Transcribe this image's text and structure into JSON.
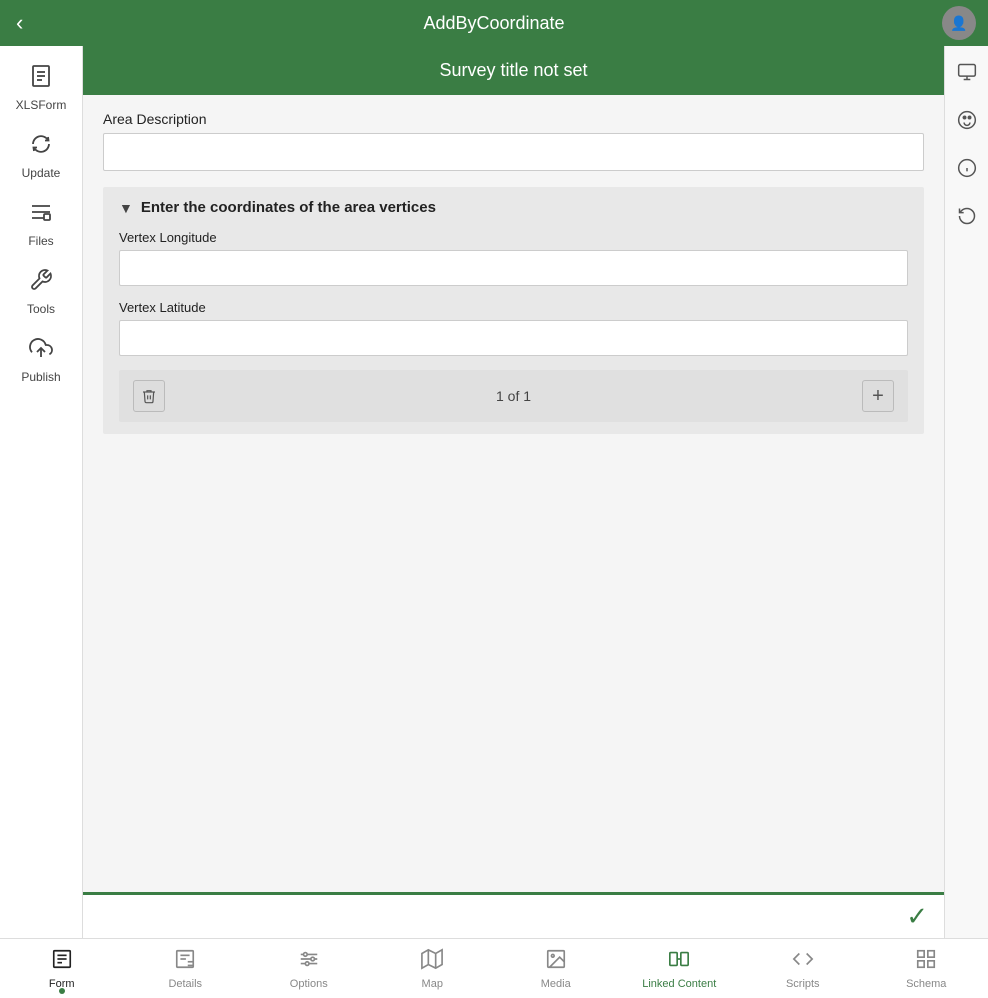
{
  "app": {
    "title": "AddByCoordinate",
    "back_label": "‹"
  },
  "survey": {
    "title": "Survey title not set"
  },
  "form": {
    "area_description_label": "Area Description",
    "area_description_value": "",
    "coord_section_title": "Enter the coordinates of the area vertices",
    "vertex_longitude_label": "Vertex Longitude",
    "vertex_longitude_value": "",
    "vertex_latitude_label": "Vertex Latitude",
    "vertex_latitude_value": "",
    "pagination_text": "1 of 1"
  },
  "sidebar": {
    "items": [
      {
        "id": "xlsform",
        "label": "XLSForm",
        "icon": "📋"
      },
      {
        "id": "update",
        "label": "Update",
        "icon": "🔄"
      },
      {
        "id": "files",
        "label": "Files",
        "icon": "📁"
      },
      {
        "id": "tools",
        "label": "Tools",
        "icon": "🔧"
      },
      {
        "id": "publish",
        "label": "Publish",
        "icon": "☁"
      }
    ],
    "dots": "···"
  },
  "right_bar": {
    "icons": [
      {
        "id": "monitor",
        "symbol": "🖥"
      },
      {
        "id": "palette",
        "symbol": "🎨"
      },
      {
        "id": "info",
        "symbol": "ℹ"
      },
      {
        "id": "reset",
        "symbol": "↺"
      }
    ]
  },
  "bottom_tabs": [
    {
      "id": "form",
      "label": "Form",
      "active": true
    },
    {
      "id": "details",
      "label": "Details",
      "active": false
    },
    {
      "id": "options",
      "label": "Options",
      "active": false
    },
    {
      "id": "map",
      "label": "Map",
      "active": false
    },
    {
      "id": "media",
      "label": "Media",
      "active": false
    },
    {
      "id": "linked-content",
      "label": "Linked Content",
      "active": false,
      "highlighted": true
    },
    {
      "id": "scripts",
      "label": "Scripts",
      "active": false
    },
    {
      "id": "schema",
      "label": "Schema",
      "active": false
    }
  ],
  "colors": {
    "green": "#3a7d44",
    "light_green": "#4CAF50"
  }
}
